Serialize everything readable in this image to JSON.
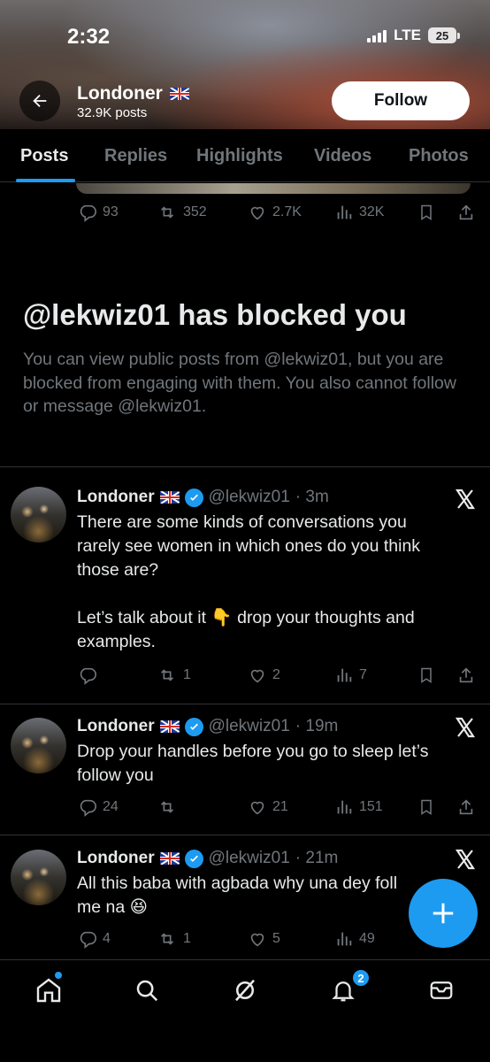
{
  "status_bar": {
    "time": "2:32",
    "network": "LTE",
    "battery": "25"
  },
  "profile": {
    "name": "Londoner",
    "posts_count": "32.9K posts",
    "follow_label": "Follow"
  },
  "tabs": [
    "Posts",
    "Replies",
    "Highlights",
    "Videos",
    "Photos"
  ],
  "prev_post_actions": {
    "replies": "93",
    "reposts": "352",
    "likes": "2.7K",
    "views": "32K"
  },
  "blocked": {
    "title": "@lekwiz01 has blocked you",
    "message": "You can view public posts from @lekwiz01, but you are blocked from engaging with them. You also cannot follow or message @lekwiz01."
  },
  "tweets": [
    {
      "name": "Londoner",
      "handle": "@lekwiz01",
      "time": "· 3m",
      "line1": "There are some kinds of conversations you",
      "line2": "rarely see women in which ones do you think",
      "line3": "those are?",
      "line4": "Let’s talk about it 👇 drop your thoughts and",
      "line5": "examples.",
      "reposts": "1",
      "likes": "2",
      "views": "7",
      "replies": ""
    },
    {
      "name": "Londoner",
      "handle": "@lekwiz01",
      "time": "· 19m",
      "line1": "Drop your handles before you go to sleep let’s",
      "line2": "follow you",
      "replies": "24",
      "reposts": "",
      "likes": "21",
      "views": "151"
    },
    {
      "name": "Londoner",
      "handle": "@lekwiz01",
      "time": "· 21m",
      "line1": "All this baba with agbada why una dey foll",
      "line2": "me na 😆",
      "replies": "4",
      "reposts": "1",
      "likes": "5",
      "views": "49"
    }
  ],
  "notifications_badge": "2",
  "colors": {
    "accent": "#1d9bf0",
    "muted": "#71767b",
    "text": "#e7e9ea",
    "background": "#000000"
  }
}
